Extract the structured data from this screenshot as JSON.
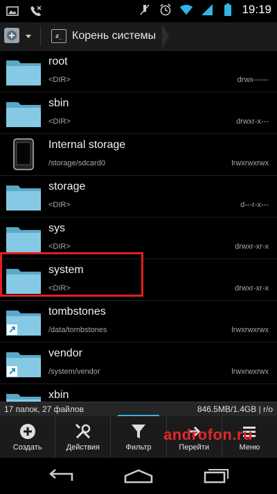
{
  "status_bar": {
    "time": "19:19",
    "left_icons": [
      "gallery-icon",
      "missed-call-icon"
    ],
    "right_icons": [
      "mute-icon",
      "alarm-icon",
      "wifi-icon",
      "signal-icon",
      "battery-icon"
    ]
  },
  "action_bar": {
    "app_icon": "app-icon",
    "breadcrumb_label": "Корень системы",
    "breadcrumb_icon_text": "#_"
  },
  "files": [
    {
      "name": "root",
      "sub": "<DIR>",
      "perm": "drwx------",
      "icon": "folder"
    },
    {
      "name": "sbin",
      "sub": "<DIR>",
      "perm": "drwxr-x---",
      "icon": "folder"
    },
    {
      "name": "Internal storage",
      "sub": "/storage/sdcard0",
      "perm": "lrwxrwxrwx",
      "icon": "phone"
    },
    {
      "name": "storage",
      "sub": "<DIR>",
      "perm": "d---r-x---",
      "icon": "folder"
    },
    {
      "name": "sys",
      "sub": "<DIR>",
      "perm": "drwxr-xr-x",
      "icon": "folder"
    },
    {
      "name": "system",
      "sub": "<DIR>",
      "perm": "drwxr-xr-x",
      "icon": "folder"
    },
    {
      "name": "tombstones",
      "sub": "/data/tombstones",
      "perm": "lrwxrwxrwx",
      "icon": "folder-link"
    },
    {
      "name": "vendor",
      "sub": "/system/vendor",
      "perm": "lrwxrwxrwx",
      "icon": "folder-link"
    },
    {
      "name": "xbin",
      "sub": "",
      "perm": "",
      "icon": "folder"
    }
  ],
  "info_bar": {
    "summary": "17 папок, 27 файлов",
    "storage": "846.5MB/1.4GB | r/o"
  },
  "toolbar": {
    "buttons": [
      {
        "label": "Создать",
        "icon": "add-icon"
      },
      {
        "label": "Действия",
        "icon": "tools-icon"
      },
      {
        "label": "Фильтр",
        "icon": "filter-icon"
      },
      {
        "label": "Перейти",
        "icon": "goto-icon"
      },
      {
        "label": "Меню",
        "icon": "menu-icon"
      }
    ]
  },
  "watermark": "androfon.ru",
  "colors": {
    "folder": "#7ec3dd",
    "accent": "#33b5e5",
    "highlight": "#e02020"
  }
}
